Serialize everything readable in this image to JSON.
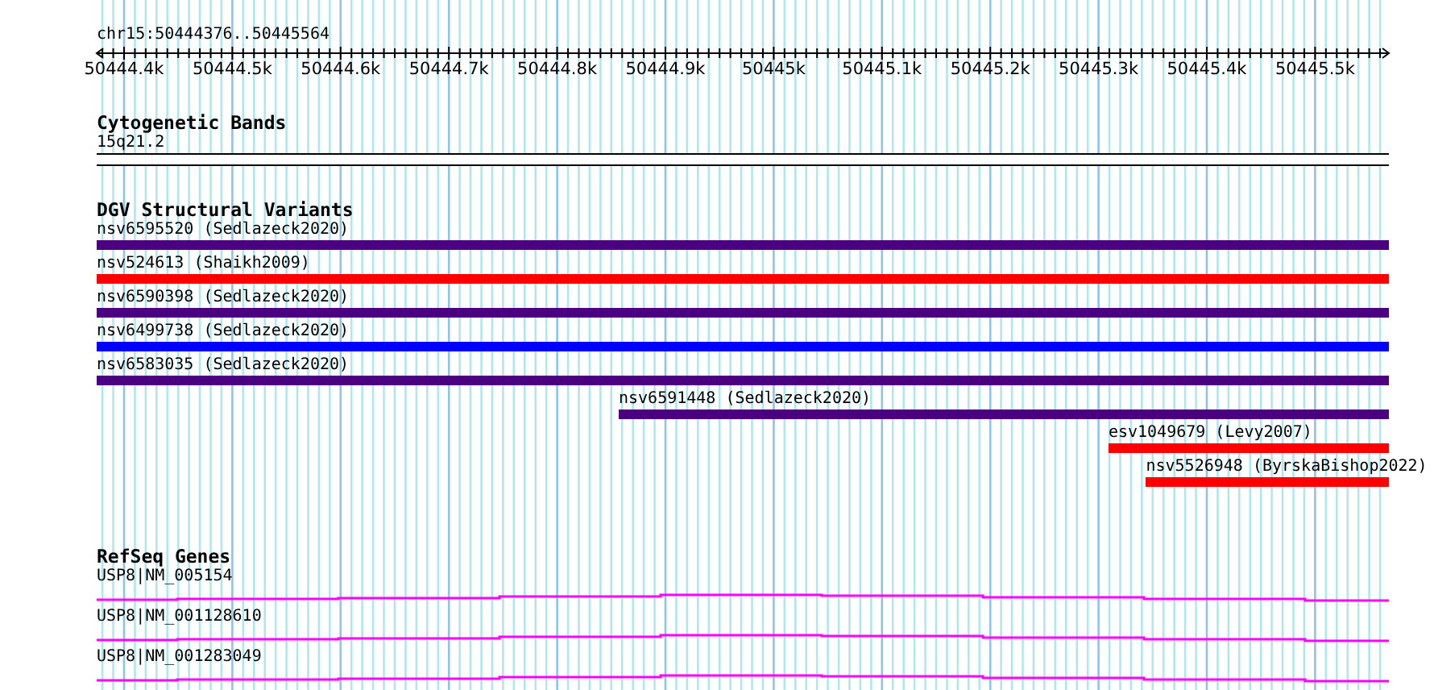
{
  "ruler": {
    "location": "chr15:50444376..50445564",
    "ticks": [
      "50444.4k",
      "50444.5k",
      "50444.6k",
      "50444.7k",
      "50444.8k",
      "50444.9k",
      "50445k",
      "50445.1k",
      "50445.2k",
      "50445.3k",
      "50445.4k",
      "50445.5k"
    ]
  },
  "tracks": [
    {
      "kind": "bands",
      "title": "Cytogenetic Bands",
      "features": [
        {
          "label": "15q21.2"
        }
      ]
    },
    {
      "kind": "variants",
      "title": "DGV Structural Variants",
      "features": [
        {
          "label": "nsv6595520 (Sedlazeck2020)",
          "color": "#4b0082"
        },
        {
          "label": "nsv524613 (Shaikh2009)",
          "color": "#ff0000"
        },
        {
          "label": "nsv6590398 (Sedlazeck2020)",
          "color": "#4b0082"
        },
        {
          "label": "nsv6499738 (Sedlazeck2020)",
          "color": "#0000ff"
        },
        {
          "label": "nsv6583035 (Sedlazeck2020)",
          "color": "#4b0082"
        },
        {
          "label": "nsv6591448 (Sedlazeck2020)",
          "color": "#4b0082"
        },
        {
          "label": "esv1049679 (Levy2007)",
          "color": "#ff0000"
        },
        {
          "label": "nsv5526948 (ByrskaBishop2022)",
          "color": "#ff0000"
        }
      ]
    },
    {
      "kind": "genes",
      "title": "RefSeq Genes",
      "features": [
        {
          "label": "USP8|NM_005154"
        },
        {
          "label": "USP8|NM_001128610"
        },
        {
          "label": "USP8|NM_001283049"
        }
      ]
    }
  ]
}
